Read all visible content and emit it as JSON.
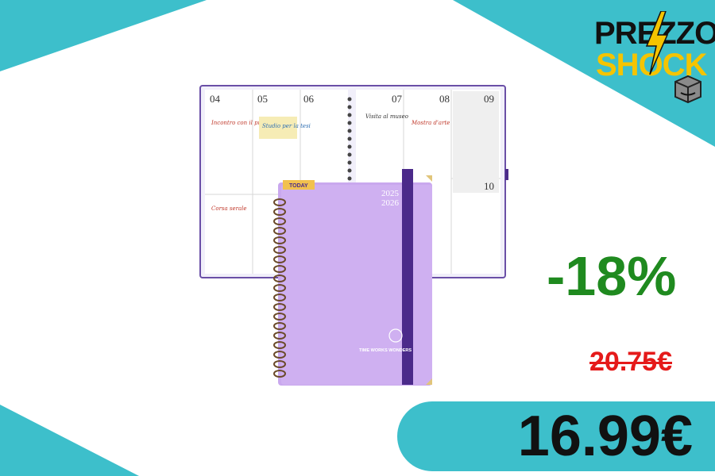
{
  "badge": {
    "line1": "PREZZO",
    "line2": "SHOCK",
    "bolt_icon": "lightning-bolt-icon",
    "box_icon": "package-icon"
  },
  "product": {
    "name": "2025 2026 weekly planner",
    "cover_year_top": "2025",
    "cover_year_bottom": "2026",
    "tab_label": "TODAY",
    "brand": "TIME WORKS WONDERS",
    "cover_color": "#c9a8ee",
    "band_color": "#4b2a8a",
    "inside_days": [
      "04",
      "05",
      "06",
      "07",
      "08",
      "09",
      "10"
    ],
    "inside_notes": [
      "Incontro con il professore",
      "Studio per la tesi",
      "Visita al museo",
      "Mostra d'arte",
      "Corsa serale"
    ]
  },
  "pricing": {
    "discount": "-18%",
    "old_price": "20.75€",
    "new_price": "16.99€"
  },
  "colors": {
    "accent": "#3dbfcb",
    "discount": "#1f8a1f",
    "old_price": "#e51a1a",
    "badge_yellow": "#f5c400"
  }
}
